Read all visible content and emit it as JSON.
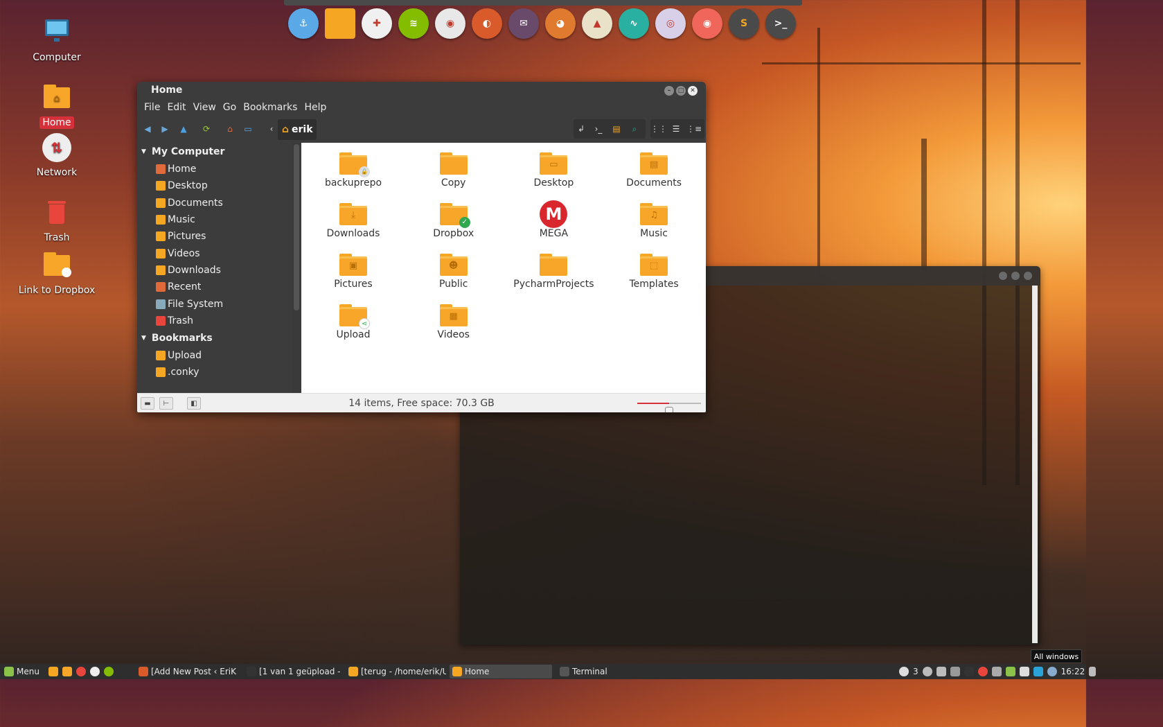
{
  "desktop": {
    "icons": [
      {
        "label": "Computer",
        "icon": "monitor-icon",
        "selected": false
      },
      {
        "label": "Home",
        "icon": "home-folder-icon",
        "selected": true
      },
      {
        "label": "Network",
        "icon": "network-icon",
        "selected": false
      },
      {
        "label": "Trash",
        "icon": "trash-icon",
        "selected": false
      },
      {
        "label": "Link to Dropbox",
        "icon": "dropbox-link-icon",
        "selected": false
      }
    ]
  },
  "dock": {
    "items": [
      {
        "icon": "anchor-icon",
        "color": "#5aa9e6",
        "glyph": "⚓"
      },
      {
        "icon": "files-icon",
        "color": "#f5a623",
        "glyph": ""
      },
      {
        "icon": "photos-icon",
        "color": "#f0f0f0",
        "glyph": "✚"
      },
      {
        "icon": "spotify-icon",
        "color": "#84bd00",
        "glyph": "≋"
      },
      {
        "icon": "chrome-icon",
        "color": "#e8e8e8",
        "glyph": "◉"
      },
      {
        "icon": "firefox-icon",
        "color": "#d95b2b",
        "glyph": "◐"
      },
      {
        "icon": "mail-icon",
        "color": "#6a4a6a",
        "glyph": "✉"
      },
      {
        "icon": "gimp-icon",
        "color": "#e07a2e",
        "glyph": "◕"
      },
      {
        "icon": "inkscape-icon",
        "color": "#e9e2c8",
        "glyph": "▲"
      },
      {
        "icon": "system-monitor-icon",
        "color": "#2ab0a0",
        "glyph": "∿"
      },
      {
        "icon": "camera-icon",
        "color": "#d8d0e8",
        "glyph": "◎"
      },
      {
        "icon": "screen-recorder-icon",
        "color": "#f0665a",
        "glyph": "◉"
      },
      {
        "icon": "sublime-text-icon",
        "color": "#4a4a4a",
        "glyph": "S"
      },
      {
        "icon": "terminal-icon",
        "color": "#4a4a4a",
        "glyph": ">_"
      }
    ]
  },
  "file_manager": {
    "title": "Home",
    "menu": [
      "File",
      "Edit",
      "View",
      "Go",
      "Bookmarks",
      "Help"
    ],
    "path": "erik",
    "sidebar": {
      "my_computer_label": "My Computer",
      "my_computer_items": [
        {
          "label": "Home",
          "icon": "home-icon"
        },
        {
          "label": "Desktop",
          "icon": "desktop-icon"
        },
        {
          "label": "Documents",
          "icon": "documents-icon"
        },
        {
          "label": "Music",
          "icon": "music-icon"
        },
        {
          "label": "Pictures",
          "icon": "pictures-icon"
        },
        {
          "label": "Videos",
          "icon": "videos-icon"
        },
        {
          "label": "Downloads",
          "icon": "downloads-icon"
        },
        {
          "label": "Recent",
          "icon": "recent-icon"
        },
        {
          "label": "File System",
          "icon": "filesystem-icon"
        },
        {
          "label": "Trash",
          "icon": "trash-icon"
        }
      ],
      "bookmarks_label": "Bookmarks",
      "bookmark_items": [
        {
          "label": "Upload",
          "icon": "upload-folder-icon"
        },
        {
          "label": ".conky",
          "icon": "folder-icon"
        }
      ]
    },
    "files": [
      {
        "name": "backuprepo",
        "emblem": "",
        "badge": "lock"
      },
      {
        "name": "Copy",
        "emblem": "",
        "badge": ""
      },
      {
        "name": "Desktop",
        "emblem": "▭",
        "badge": ""
      },
      {
        "name": "Documents",
        "emblem": "▤",
        "badge": ""
      },
      {
        "name": "Downloads",
        "emblem": "⤓",
        "badge": ""
      },
      {
        "name": "Dropbox",
        "emblem": "",
        "badge": "check"
      },
      {
        "name": "MEGA",
        "emblem": "M",
        "badge": "mega"
      },
      {
        "name": "Music",
        "emblem": "♫",
        "badge": ""
      },
      {
        "name": "Pictures",
        "emblem": "▣",
        "badge": ""
      },
      {
        "name": "Public",
        "emblem": "☻",
        "badge": ""
      },
      {
        "name": "PycharmProjects",
        "emblem": "",
        "badge": ""
      },
      {
        "name": "Templates",
        "emblem": "⬚",
        "badge": ""
      },
      {
        "name": "Upload",
        "emblem": "",
        "badge": "share"
      },
      {
        "name": "Videos",
        "emblem": "▦",
        "badge": ""
      }
    ],
    "status": "14 items, Free space: 70.3 GB",
    "zoom_level": 0.5
  },
  "taskbar": {
    "menu_label": "Menu",
    "tasks": [
      {
        "label": "[Add New Post ‹ EriK ...",
        "icon_color": "#d95b2b",
        "active": false
      },
      {
        "label": "[1 van 1 geüpload - Y...",
        "icon_color": "#333333",
        "active": false
      },
      {
        "label": "[terug - /home/erik/U...",
        "icon_color": "#f5a623",
        "active": false
      },
      {
        "label": "Home",
        "icon_color": "#f5a623",
        "active": true
      },
      {
        "label": "Terminal",
        "icon_color": "#555555",
        "active": false
      }
    ],
    "workspace": "3",
    "clock": "16:22",
    "tooltip": "All windows"
  }
}
